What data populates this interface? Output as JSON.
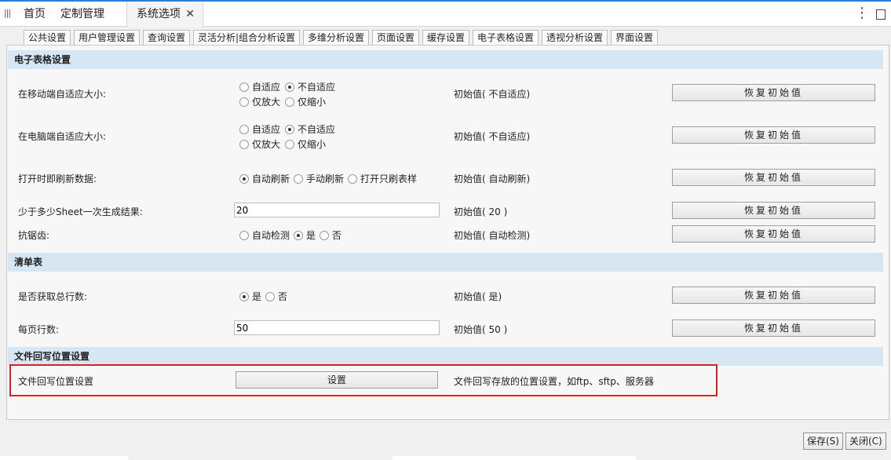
{
  "topbar": {
    "nav_home": "首页",
    "nav_custom": "定制管理",
    "active_tab": "系统选项",
    "close_glyph": "✕",
    "more_glyph": "⋮"
  },
  "subtabs": [
    "公共设置",
    "用户管理设置",
    "查询设置",
    "灵活分析|组合分析设置",
    "多维分析设置",
    "页面设置",
    "缓存设置",
    "电子表格设置",
    "透视分析设置",
    "界面设置"
  ],
  "active_subtab": "电子表格设置",
  "sections": {
    "spreadsheet": "电子表格设置",
    "list": "清单表",
    "file_writeback": "文件回写位置设置"
  },
  "reset_label": "恢复初始值",
  "rows": {
    "mobile_adapt": {
      "label": "在移动端自适应大小:",
      "options": [
        "自适应",
        "不自适应",
        "仅放大",
        "仅缩小"
      ],
      "selected": "不自适应",
      "initial": "初始值( 不自适应)"
    },
    "pc_adapt": {
      "label": "在电脑端自适应大小:",
      "options": [
        "自适应",
        "不自适应",
        "仅放大",
        "仅缩小"
      ],
      "selected": "不自适应",
      "initial": "初始值( 不自适应)"
    },
    "refresh_on_open": {
      "label": "打开时即刷新数据:",
      "options": [
        "自动刷新",
        "手动刷新",
        "打开只刷表样"
      ],
      "selected": "自动刷新",
      "initial": "初始值( 自动刷新)"
    },
    "sheet_batch": {
      "label": "少于多少Sheet一次生成结果:",
      "value": "20",
      "initial": "初始值( 20 )"
    },
    "antialias": {
      "label": "抗锯齿:",
      "options": [
        "自动检测",
        "是",
        "否"
      ],
      "selected": "是",
      "initial": "初始值( 自动检测)"
    },
    "total_rows": {
      "label": "是否获取总行数:",
      "options": [
        "是",
        "否"
      ],
      "selected": "是",
      "initial": "初始值( 是)"
    },
    "page_rows": {
      "label": "每页行数:",
      "value": "50",
      "initial": "初始值( 50 )"
    },
    "file_writeback": {
      "label": "文件回写位置设置",
      "button": "设置",
      "description": "文件回写存放的位置设置，如ftp、sftp、服务器"
    }
  },
  "footer": {
    "save": "保存(S)",
    "close": "关闭(C)"
  },
  "colors": {
    "accent": "#2d7fd3",
    "section_header_bg": "#d6e6f3",
    "highlight_frame": "#e02020"
  }
}
